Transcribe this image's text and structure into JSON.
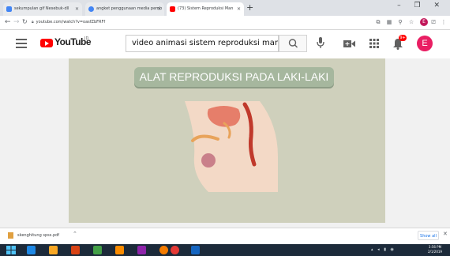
{
  "browser": {
    "tabs": [
      {
        "label": "sekumpulan gif Nesebuk-dll",
        "favicon_color": "#4285f4"
      },
      {
        "label": "angket penggunaan media pemb",
        "favicon_color": "#4285f4"
      },
      {
        "label": "(73) Sistem Reproduksi Man",
        "favicon_color": "#ff0000"
      }
    ],
    "new_tab": "+",
    "window_controls": "– ❐ ✕",
    "url": "youtube.com/watch?v=oasfZbFRFf",
    "profile_letter": "E"
  },
  "youtube": {
    "logo_text": "YouTube",
    "country_code": "ID",
    "search_query": "video animasi sistem reproduksi manusia",
    "notification_count": "9+",
    "avatar_letter": "E"
  },
  "video": {
    "title_text": "ALAT REPRODUKSI PADA LAKI-LAKI",
    "background_color": "#cfd0bc",
    "banner_color": "#a6b79e"
  },
  "downloads": {
    "file_name": "skenghitung spss.pdf",
    "show_all": "Show all",
    "close": "✕"
  },
  "taskbar": {
    "time": "3:56 PM",
    "date": "2/1/2019"
  },
  "icons": [
    "menu-icon",
    "search-icon",
    "mic-icon",
    "video-camera-icon",
    "apps-grid-icon",
    "bell-icon",
    "windows-start-icon"
  ]
}
